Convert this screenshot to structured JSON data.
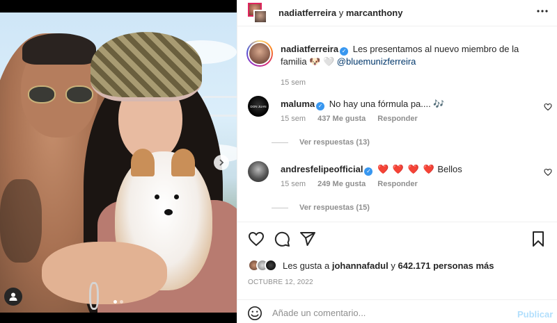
{
  "header": {
    "user1": "nadiatferreira",
    "connector": "y",
    "user2": "marcanthony",
    "more_icon": "more-horizontal-icon"
  },
  "caption": {
    "user": "nadiatferreira",
    "text": "Les presentamos al nuevo miembro de la familia 🐶 🤍 ",
    "mention": "@bluemunizferreira",
    "time": "15 sem"
  },
  "comments": [
    {
      "user": "maluma",
      "verified": true,
      "text": "No hay una fórmula pa.... 🎶",
      "time": "15 sem",
      "likes": "437 Me gusta",
      "reply": "Responder",
      "view_replies": "Ver respuestas (13)"
    },
    {
      "user": "andresfelipeofficial",
      "verified": true,
      "hearts": "❤️ ❤️ ❤️ ❤️",
      "text": "Bellos",
      "time": "15 sem",
      "likes": "249 Me gusta",
      "reply": "Responder",
      "view_replies": "Ver respuestas (15)"
    }
  ],
  "likes": {
    "prefix": "Les gusta a",
    "user": "johannafadul",
    "middle": "y",
    "count": "642.171 personas más"
  },
  "date": "OCTUBRE 12, 2022",
  "composer": {
    "placeholder": "Añade un comentario...",
    "post": "Publicar"
  },
  "colors": {
    "link": "#00376b",
    "verified": "#3897f0",
    "post_disabled": "#b2dffc",
    "heart": "#ed4956"
  },
  "icons": [
    "heart-icon",
    "comment-icon",
    "share-icon",
    "bookmark-icon",
    "emoji-icon",
    "user-tag-icon",
    "chevron-right-icon"
  ],
  "carousel": {
    "current": 1,
    "total": 2
  }
}
